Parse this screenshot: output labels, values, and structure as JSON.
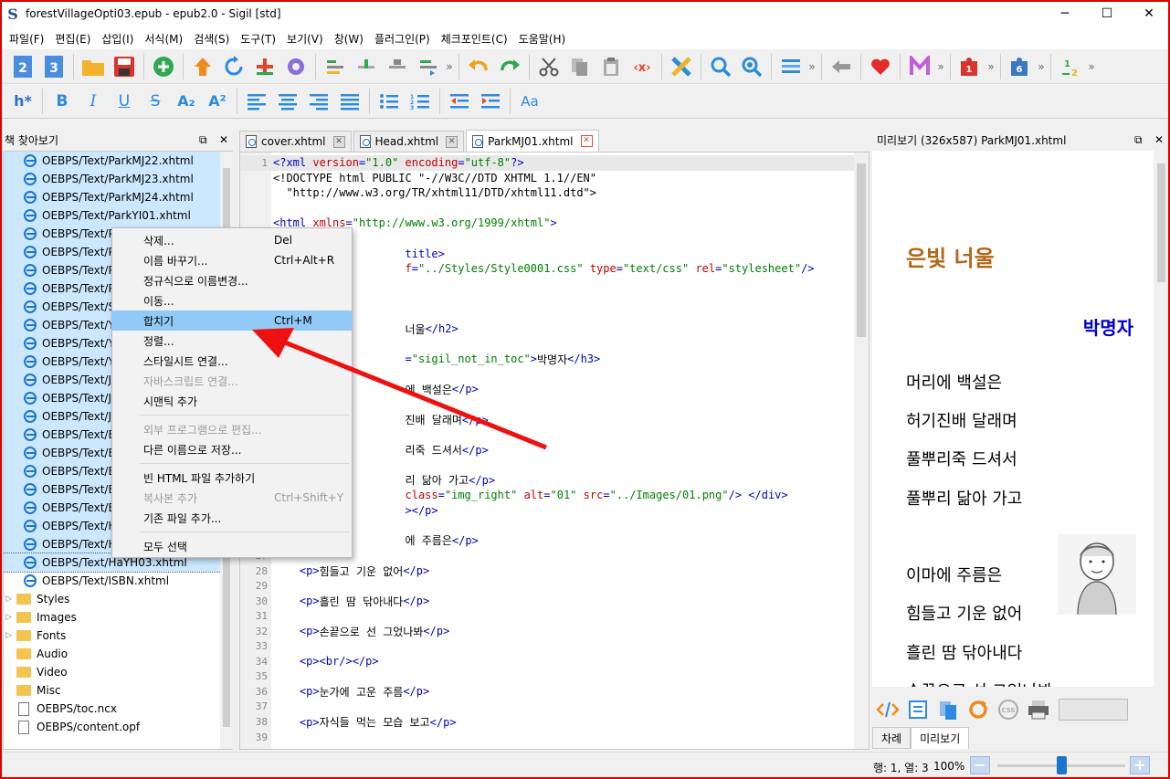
{
  "window": {
    "title": "forestVillageOpti03.epub - epub2.0 - Sigil [std]",
    "minimize": "─",
    "maximize": "☐",
    "close": "✕",
    "app_icon": "S"
  },
  "menu": [
    "파일(F)",
    "편집(E)",
    "삽입(I)",
    "서식(M)",
    "검색(S)",
    "도구(T)",
    "보기(V)",
    "창(W)",
    "플러그인(P)",
    "체크포인트(C)",
    "도움말(H)"
  ],
  "toolbar2": {
    "heading": "h*",
    "bold": "B",
    "italic": "I",
    "underline": "U",
    "strike": "S",
    "sub": "A₂",
    "sup": "A²",
    "font": "Aa"
  },
  "book_browser": {
    "title": "책 찾아보기",
    "float": "⧉",
    "close": "✕",
    "files": [
      "OEBPS/Text/ParkMJ22.xhtml",
      "OEBPS/Text/ParkMJ23.xhtml",
      "OEBPS/Text/ParkMJ24.xhtml",
      "OEBPS/Text/ParkYI01.xhtml",
      "OEBPS/Text/Pa",
      "OEBPS/Text/Pa",
      "OEBPS/Text/Pa",
      "OEBPS/Text/Pa",
      "OEBPS/Text/Se",
      "OEBPS/Text/Yo",
      "OEBPS/Text/Yo",
      "OEBPS/Text/Yo",
      "OEBPS/Text/JY",
      "OEBPS/Text/JY",
      "OEBPS/Text/JY",
      "OEBPS/Text/Ba",
      "OEBPS/Text/Ba",
      "OEBPS/Text/Ba",
      "OEBPS/Text/Ba",
      "OEBPS/Text/Ba",
      "OEBPS/Text/H",
      "OEBPS/Text/H",
      "OEBPS/Text/HaYH03.xhtml",
      "OEBPS/Text/ISBN.xhtml"
    ],
    "folders": [
      "Styles",
      "Images",
      "Fonts",
      "Audio",
      "Video",
      "Misc"
    ],
    "root_files": [
      "OEBPS/toc.ncx",
      "OEBPS/content.opf"
    ]
  },
  "context_menu": {
    "items": [
      {
        "label": "삭제...",
        "shortcut": "Del",
        "disabled": false
      },
      {
        "label": "이름 바꾸기...",
        "shortcut": "Ctrl+Alt+R",
        "disabled": false
      },
      {
        "label": "정규식으로 이름변경...",
        "shortcut": "",
        "disabled": false
      },
      {
        "label": "이동...",
        "shortcut": "",
        "disabled": false
      },
      {
        "label": "합치기",
        "shortcut": "Ctrl+M",
        "disabled": false,
        "highlighted": true
      },
      {
        "label": "정렬...",
        "shortcut": "",
        "disabled": false
      },
      {
        "label": "스타일시트 연결...",
        "shortcut": "",
        "disabled": false
      },
      {
        "label": "자바스크립트 연결...",
        "shortcut": "",
        "disabled": true
      },
      {
        "label": "시맨틱 추가",
        "shortcut": "",
        "disabled": false
      },
      {
        "sep": true
      },
      {
        "label": "외부 프로그램으로 편집...",
        "shortcut": "",
        "disabled": true
      },
      {
        "label": "다른 이름으로 저장...",
        "shortcut": "",
        "disabled": false
      },
      {
        "sep": true
      },
      {
        "label": "빈 HTML 파일 추가하기",
        "shortcut": "",
        "disabled": false
      },
      {
        "label": "복사본 추가",
        "shortcut": "Ctrl+Shift+Y",
        "disabled": true
      },
      {
        "label": "기존 파일 추가...",
        "shortcut": "",
        "disabled": false
      },
      {
        "sep": true
      },
      {
        "label": "모두 선택",
        "shortcut": "",
        "disabled": false
      }
    ]
  },
  "tabs": [
    {
      "label": "cover.xhtml",
      "active": false
    },
    {
      "label": "Head.xhtml",
      "active": false
    },
    {
      "label": "ParkMJ01.xhtml",
      "active": true
    }
  ],
  "code_lines": [
    {
      "n": "1",
      "hl": true,
      "parts": [
        [
          "t-tag",
          "<?xml "
        ],
        [
          "t-attr",
          "version"
        ],
        [
          "t-tag",
          "="
        ],
        [
          "t-val",
          "\"1.0\""
        ],
        [
          "t-tag",
          " "
        ],
        [
          "t-attr",
          "encoding"
        ],
        [
          "t-tag",
          "="
        ],
        [
          "t-val",
          "\"utf-8\""
        ],
        [
          "t-tag",
          "?>"
        ]
      ]
    },
    {
      "n": "",
      "parts": [
        [
          "t-txt",
          "<!DOCTYPE html PUBLIC \"-//W3C//DTD XHTML 1.1//EN\""
        ]
      ]
    },
    {
      "n": "",
      "parts": [
        [
          "t-txt",
          "  \"http://www.w3.org/TR/xhtml11/DTD/xhtml11.dtd\">"
        ]
      ]
    },
    {
      "n": "",
      "parts": []
    },
    {
      "n": "",
      "parts": [
        [
          "t-tag",
          "<html "
        ],
        [
          "t-attr",
          "xmlns"
        ],
        [
          "t-tag",
          "="
        ],
        [
          "t-val",
          "\"http://www.w3.org/1999/xhtml\""
        ],
        [
          "t-tag",
          ">"
        ]
      ]
    },
    {
      "n": "",
      "parts": []
    },
    {
      "n": "",
      "parts": [
        [
          "t-tag",
          "                    title>"
        ]
      ]
    },
    {
      "n": "",
      "parts": [
        [
          "t-attr",
          "                    f"
        ],
        [
          "t-tag",
          "="
        ],
        [
          "t-val",
          "\"../Styles/Style0001.css\""
        ],
        [
          "t-tag",
          " "
        ],
        [
          "t-attr",
          "type"
        ],
        [
          "t-tag",
          "="
        ],
        [
          "t-val",
          "\"text/css\""
        ],
        [
          "t-tag",
          " "
        ],
        [
          "t-attr",
          "rel"
        ],
        [
          "t-tag",
          "="
        ],
        [
          "t-val",
          "\"stylesheet\""
        ],
        [
          "t-tag",
          "/>"
        ]
      ]
    },
    {
      "n": "",
      "parts": []
    },
    {
      "n": "",
      "parts": []
    },
    {
      "n": "",
      "parts": []
    },
    {
      "n": "",
      "parts": [
        [
          "t-txt",
          "                    너울"
        ],
        [
          "t-tag",
          "</h2>"
        ]
      ]
    },
    {
      "n": "",
      "parts": []
    },
    {
      "n": "",
      "parts": [
        [
          "t-tag",
          "                    ="
        ],
        [
          "t-val",
          "\"sigil_not_in_toc\""
        ],
        [
          "t-tag",
          ">"
        ],
        [
          "t-txt",
          "박명자"
        ],
        [
          "t-tag",
          "</h3>"
        ]
      ]
    },
    {
      "n": "",
      "parts": []
    },
    {
      "n": "",
      "parts": [
        [
          "t-txt",
          "                    에 백설은"
        ],
        [
          "t-tag",
          "</p>"
        ]
      ]
    },
    {
      "n": "",
      "parts": []
    },
    {
      "n": "",
      "parts": [
        [
          "t-txt",
          "                    진배 달래며"
        ],
        [
          "t-tag",
          "</p>"
        ]
      ]
    },
    {
      "n": "",
      "parts": []
    },
    {
      "n": "",
      "parts": [
        [
          "t-txt",
          "                    리죽 드셔서"
        ],
        [
          "t-tag",
          "</p>"
        ]
      ]
    },
    {
      "n": "",
      "parts": []
    },
    {
      "n": "",
      "parts": [
        [
          "t-txt",
          "                    리 닮아 가고"
        ],
        [
          "t-tag",
          "</p>"
        ]
      ]
    },
    {
      "n": "",
      "parts": [
        [
          "t-tag",
          "                    "
        ],
        [
          "t-attr",
          "class"
        ],
        [
          "t-tag",
          "="
        ],
        [
          "t-val",
          "\"img_right\""
        ],
        [
          "t-tag",
          " "
        ],
        [
          "t-attr",
          "alt"
        ],
        [
          "t-tag",
          "="
        ],
        [
          "t-val",
          "\"01\""
        ],
        [
          "t-tag",
          " "
        ],
        [
          "t-attr",
          "src"
        ],
        [
          "t-tag",
          "="
        ],
        [
          "t-val",
          "\"../Images/01.png\""
        ],
        [
          "t-tag",
          "/> </div>"
        ]
      ]
    },
    {
      "n": "",
      "parts": [
        [
          "t-tag",
          "                    ></p>"
        ]
      ]
    },
    {
      "n": "",
      "parts": []
    },
    {
      "n": "",
      "parts": [
        [
          "t-txt",
          "                    에 주름은"
        ],
        [
          "t-tag",
          "</p>"
        ]
      ]
    },
    {
      "n": "27",
      "parts": []
    },
    {
      "n": "28",
      "parts": [
        [
          "t-txt",
          "    "
        ],
        [
          "t-tag",
          "<p>"
        ],
        [
          "t-txt",
          "힘들고 기운 없어"
        ],
        [
          "t-tag",
          "</p>"
        ]
      ]
    },
    {
      "n": "29",
      "parts": []
    },
    {
      "n": "30",
      "parts": [
        [
          "t-txt",
          "    "
        ],
        [
          "t-tag",
          "<p>"
        ],
        [
          "t-txt",
          "흘린 땀 닦아내다"
        ],
        [
          "t-tag",
          "</p>"
        ]
      ]
    },
    {
      "n": "31",
      "parts": []
    },
    {
      "n": "32",
      "parts": [
        [
          "t-txt",
          "    "
        ],
        [
          "t-tag",
          "<p>"
        ],
        [
          "t-txt",
          "손끝으로 선 그었나봐"
        ],
        [
          "t-tag",
          "</p>"
        ]
      ]
    },
    {
      "n": "33",
      "parts": []
    },
    {
      "n": "34",
      "parts": [
        [
          "t-txt",
          "    "
        ],
        [
          "t-tag",
          "<p><br/></p>"
        ]
      ]
    },
    {
      "n": "35",
      "parts": []
    },
    {
      "n": "36",
      "parts": [
        [
          "t-txt",
          "    "
        ],
        [
          "t-tag",
          "<p>"
        ],
        [
          "t-txt",
          "눈가에 고운 주름"
        ],
        [
          "t-tag",
          "</p>"
        ]
      ]
    },
    {
      "n": "37",
      "parts": []
    },
    {
      "n": "38",
      "parts": [
        [
          "t-txt",
          "    "
        ],
        [
          "t-tag",
          "<p>"
        ],
        [
          "t-txt",
          "자식들 먹는 모습 보고"
        ],
        [
          "t-tag",
          "</p>"
        ]
      ]
    },
    {
      "n": "39",
      "parts": []
    }
  ],
  "preview": {
    "title": "미리보기 (326x587) ParkMJ01.xhtml",
    "float": "⧉",
    "close": "✕",
    "poem_title": "은빛 너울",
    "author": "박명자",
    "lines": [
      "머리에 백설은",
      "허기진배 달래며",
      "풀뿌리죽 드셔서",
      "풀뿌리 닮아 가고",
      "이마에 주름은",
      "힘들고 기운 없어",
      "흘린 땀 닦아내다",
      "손끝으로 선 그었나봐"
    ],
    "tabs": [
      "차례",
      "미리보기"
    ]
  },
  "status": {
    "position": "행: 1, 열: 3",
    "zoom": "100%",
    "zoom_out": "−",
    "zoom_in": "+",
    "zoom_level": 0.5
  },
  "annotation": {
    "arrow_color": "#ee1111"
  }
}
